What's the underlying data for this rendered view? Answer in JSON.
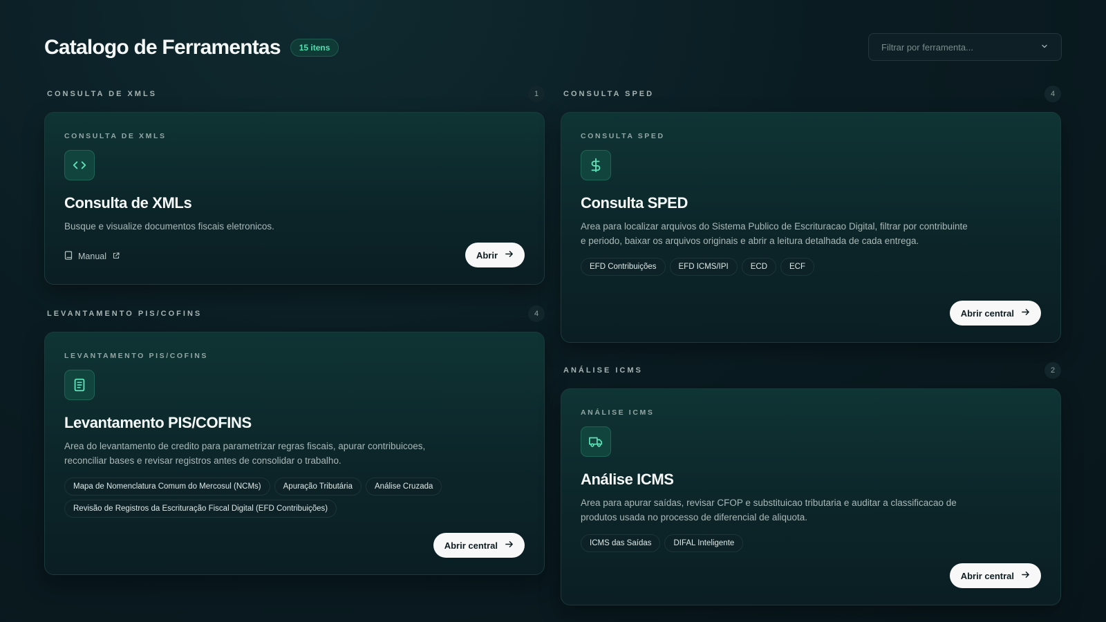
{
  "header": {
    "title": "Catalogo de Ferramentas",
    "count_badge": "15 itens",
    "filter_placeholder": "Filtrar por ferramenta..."
  },
  "sections": {
    "xmls": {
      "title": "CONSULTA DE XMLS",
      "count": "1",
      "card": {
        "kicker": "CONSULTA DE XMLS",
        "icon": "code-icon",
        "title": "Consulta de XMLs",
        "description": "Busque e visualize documentos fiscais eletronicos.",
        "manual_label": "Manual",
        "button_label": "Abrir"
      }
    },
    "sped": {
      "title": "CONSULTA SPED",
      "count": "4",
      "card": {
        "kicker": "CONSULTA SPED",
        "icon": "dollar-icon",
        "title": "Consulta SPED",
        "description": "Area para localizar arquivos do Sistema Publico de Escrituracao Digital, filtrar por contribuinte e periodo, baixar os arquivos originais e abrir a leitura detalhada de cada entrega.",
        "tags": [
          "EFD Contribuições",
          "EFD ICMS/IPI",
          "ECD",
          "ECF"
        ],
        "button_label": "Abrir central"
      }
    },
    "pis": {
      "title": "LEVANTAMENTO PIS/COFINS",
      "count": "4",
      "card": {
        "kicker": "LEVANTAMENTO PIS/COFINS",
        "icon": "document-icon",
        "title": "Levantamento PIS/COFINS",
        "description": "Area do levantamento de credito para parametrizar regras fiscais, apurar contribuicoes, reconciliar bases e revisar registros antes de consolidar o trabalho.",
        "tags": [
          "Mapa de Nomenclatura Comum do Mercosul (NCMs)",
          "Apuração Tributária",
          "Análise Cruzada",
          "Revisão de Registros da Escrituração Fiscal Digital (EFD Contribuições)"
        ],
        "button_label": "Abrir central"
      }
    },
    "icms": {
      "title": "ANÁLISE ICMS",
      "count": "2",
      "card": {
        "kicker": "ANÁLISE ICMS",
        "icon": "truck-icon",
        "title": "Análise ICMS",
        "description": "Area para apurar saídas, revisar CFOP e substituicao tributaria e auditar a classificacao de produtos usada no processo de diferencial de aliquota.",
        "tags": [
          "ICMS das Saídas",
          "DIFAL Inteligente"
        ],
        "button_label": "Abrir central"
      }
    }
  },
  "colors": {
    "accent": "#4fe0b0",
    "background": "#0a1c22",
    "button_bg": "#f7f8f7"
  }
}
